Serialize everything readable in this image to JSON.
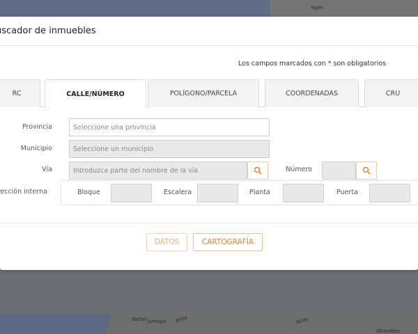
{
  "map": {
    "labels": [
      "Agen",
      "Bettel",
      "Jumoga",
      "Atlas",
      "Atlas",
      "Oharddes"
    ]
  },
  "dialog": {
    "title": "uscador de inmuebles",
    "required_note": "Los campos marcados con * son obligatorios",
    "tabs": [
      {
        "label": "RC",
        "active": false
      },
      {
        "label": "CALLE/NÚMERO",
        "active": true
      },
      {
        "label": "POLÍGONO/PARCELA",
        "active": false
      },
      {
        "label": "COORDENADAS",
        "active": false
      },
      {
        "label": "CRU",
        "active": false
      }
    ],
    "form": {
      "provincia_label": "Provincia",
      "provincia_placeholder": "Seleccione una provincia",
      "municipio_label": "Municipio",
      "municipio_placeholder": "Seleccione un municipio",
      "via_label": "Vía",
      "via_placeholder": "Introduzca parte del nombre de la vía",
      "numero_label": "Número",
      "direccion_label": "irección interna",
      "bloque_label": "Bloque",
      "escalera_label": "Escalera",
      "planta_label": "Planta",
      "puerta_label": "Puerta"
    },
    "buttons": {
      "datos": "DATOS",
      "cartografia": "CARTOGRAFÍA"
    },
    "colors": {
      "accent": "#d98a2c",
      "accent_light": "#e8b27a",
      "disabled_bg": "#e9e9e9"
    }
  }
}
